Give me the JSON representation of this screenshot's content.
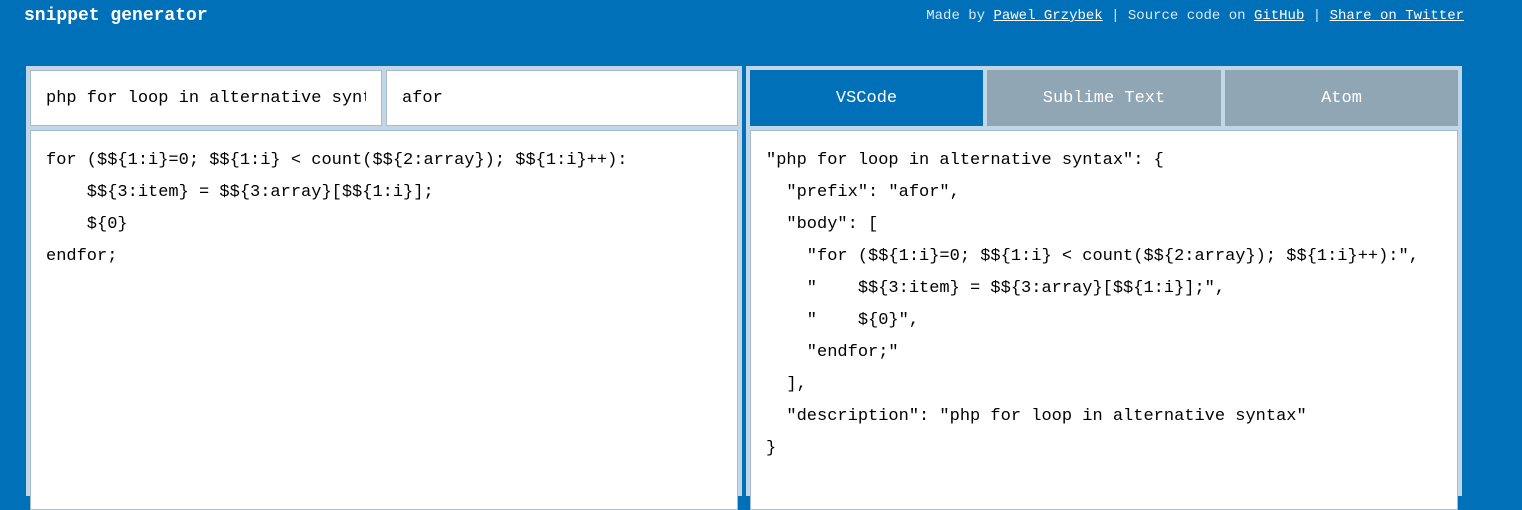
{
  "header": {
    "title": "snippet generator",
    "made_by_prefix": "Made by",
    "author_link": "Pawel Grzybek",
    "separator": "|",
    "source_prefix": "Source code on",
    "github_link": "GitHub",
    "twitter_link": "Share on Twitter"
  },
  "inputs": {
    "description_value": "php for loop in alternative syntax",
    "prefix_value": "afor"
  },
  "editor": {
    "snippet_body": "for ($${1:i}=0; $${1:i} < count($${2:array}); $${1:i}++):\n    $${3:item} = $${3:array}[$${1:i}];\n    ${0}\nendfor;"
  },
  "tabs": [
    {
      "label": "VSCode",
      "active": true
    },
    {
      "label": "Sublime Text",
      "active": false
    },
    {
      "label": "Atom",
      "active": false
    }
  ],
  "output": {
    "text": "\"php for loop in alternative syntax\": {\n  \"prefix\": \"afor\",\n  \"body\": [\n    \"for ($${1:i}=0; $${1:i} < count($${2:array}); $${1:i}++):\",\n    \"    $${3:item} = $${3:array}[$${1:i}];\",\n    \"    ${0}\",\n    \"endfor;\"\n  ],\n  \"description\": \"php for loop in alternative syntax\"\n}"
  },
  "colors": {
    "background": "#0070b8",
    "active_tab": "#0070b8",
    "inactive_tab": "#90a6b4",
    "panel_border": "#c3d6e6"
  }
}
